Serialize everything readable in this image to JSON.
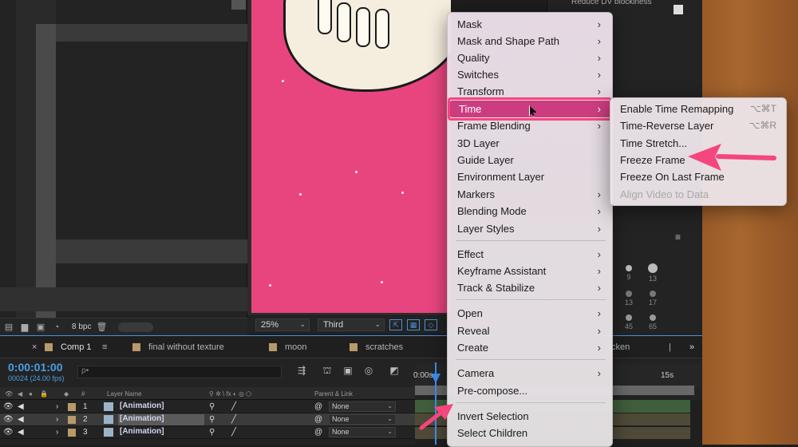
{
  "project_panel": {
    "bpc_label": "8 bpc"
  },
  "right_panel": {
    "title": "Reduce DV blockiness",
    "brushes": [
      "9",
      "13",
      "13",
      "17",
      "45",
      "65"
    ]
  },
  "viewer": {
    "zoom": "25%",
    "view": "Third"
  },
  "timeline": {
    "tabs": [
      {
        "label": "Comp 1"
      },
      {
        "label": "final without texture"
      },
      {
        "label": "moon"
      },
      {
        "label": "scratches"
      },
      {
        "label": "cken"
      }
    ],
    "timecode": "0:00:01:00",
    "frame_info": "00024 (24.00 fps)",
    "search_placeholder": "ρ•",
    "headers": {
      "number": "#",
      "layer_name": "Layer Name",
      "parent_link": "Parent & Link"
    },
    "ruler": {
      "start": "0:00s",
      "mark": "15s"
    },
    "layers": [
      {
        "index": "1",
        "name": "[Animation]",
        "parent": "None"
      },
      {
        "index": "2",
        "name": "[Animation]",
        "parent": "None"
      },
      {
        "index": "3",
        "name": "[Animation]",
        "parent": "None"
      }
    ]
  },
  "context_menu": {
    "groups": [
      [
        "Mask",
        "Mask and Shape Path",
        "Quality",
        "Switches",
        "Transform",
        "Time",
        "Frame Blending",
        "3D Layer",
        "Guide Layer",
        "Environment Layer",
        "Markers",
        "Blending Mode",
        "Layer Styles"
      ],
      [
        "Effect",
        "Keyframe Assistant",
        "Track & Stabilize"
      ],
      [
        "Open",
        "Reveal",
        "Create"
      ],
      [
        "Camera",
        "Pre-compose..."
      ],
      [
        "Invert Selection",
        "Select Children"
      ]
    ],
    "items": {
      "mask": "Mask",
      "mask_shape": "Mask and Shape Path",
      "quality": "Quality",
      "switches": "Switches",
      "transform": "Transform",
      "time": "Time",
      "frame_blending": "Frame Blending",
      "layer_3d": "3D Layer",
      "guide_layer": "Guide Layer",
      "environment_layer": "Environment Layer",
      "markers": "Markers",
      "blending_mode": "Blending Mode",
      "layer_styles": "Layer Styles",
      "effect": "Effect",
      "keyframe_assistant": "Keyframe Assistant",
      "track_stabilize": "Track & Stabilize",
      "open": "Open",
      "reveal": "Reveal",
      "create": "Create",
      "camera": "Camera",
      "precompose": "Pre-compose...",
      "invert_selection": "Invert Selection",
      "select_children": "Select Children"
    }
  },
  "time_submenu": {
    "enable_remap": "Enable Time Remapping",
    "enable_remap_shortcut": "⌥⌘T",
    "reverse": "Time-Reverse Layer",
    "reverse_shortcut": "⌥⌘R",
    "stretch": "Time Stretch...",
    "freeze": "Freeze Frame",
    "freeze_last": "Freeze On Last Frame",
    "align_video": "Align Video to Data"
  },
  "colors": {
    "menu_highlight": "#cc3d80",
    "annotation_pink": "#f5467e",
    "canvas_pink": "#e8457f",
    "timecode_blue": "#4a9fe8"
  }
}
